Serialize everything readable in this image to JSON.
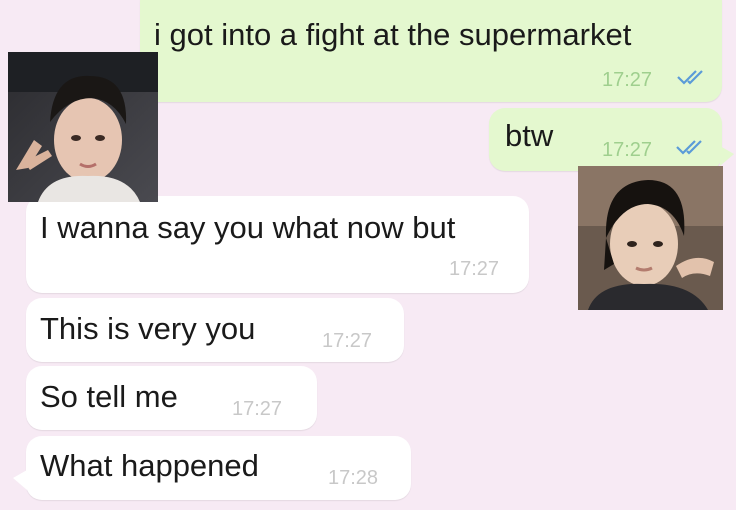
{
  "chat": {
    "messages": [
      {
        "direction": "outgoing",
        "text": "i got into a fight at the supermarket",
        "time": "17:27",
        "status": "read"
      },
      {
        "direction": "outgoing",
        "text": "btw",
        "time": "17:27",
        "status": "read"
      },
      {
        "direction": "incoming",
        "text": "I wanna say you what now but",
        "time": "17:27"
      },
      {
        "direction": "incoming",
        "text": "This is very you",
        "time": "17:27"
      },
      {
        "direction": "incoming",
        "text": "So tell me",
        "time": "17:27"
      },
      {
        "direction": "incoming",
        "text": "What happened",
        "time": "17:28"
      }
    ]
  },
  "overlays": {
    "left_photo": {
      "description_icon": "person-photo-icon"
    },
    "right_photo": {
      "description_icon": "person-photo-icon"
    }
  },
  "colors": {
    "background": "#f7eaf4",
    "outgoing_bubble": "#e4f8cf",
    "incoming_bubble": "#ffffff",
    "read_ticks": "#5b9bd8"
  }
}
